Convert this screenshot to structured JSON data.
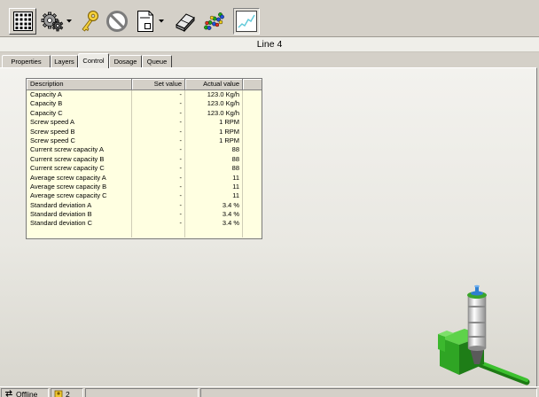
{
  "toolbar": {
    "buttons": [
      {
        "icon": "keypad-icon"
      },
      {
        "icon": "gear-icon",
        "has_dropdown": true
      },
      {
        "icon": "key-icon"
      },
      {
        "icon": "no-entry-icon"
      },
      {
        "icon": "document-icon",
        "has_dropdown": true
      },
      {
        "icon": "eraser-icon"
      },
      {
        "icon": "scatter-plot-icon"
      },
      {
        "icon": "line-chart-icon",
        "pressed": true
      }
    ]
  },
  "title": "Line 4",
  "tabs": [
    {
      "label": "Properties"
    },
    {
      "label": "Layers"
    },
    {
      "label": "Control",
      "active": true
    },
    {
      "label": "Dosage"
    },
    {
      "label": "Queue"
    }
  ],
  "table": {
    "headers": {
      "description": "Description",
      "set_value": "Set value",
      "actual_value": "Actual value"
    },
    "rows": [
      {
        "description": "Capacity A",
        "set_value": "-",
        "actual_value": "123.0 Kg/h"
      },
      {
        "description": "Capacity B",
        "set_value": "-",
        "actual_value": "123.0 Kg/h"
      },
      {
        "description": "Capacity C",
        "set_value": "-",
        "actual_value": "123.0 Kg/h"
      },
      {
        "description": "Screw speed A",
        "set_value": "-",
        "actual_value": "1 RPM"
      },
      {
        "description": "Screw speed B",
        "set_value": "-",
        "actual_value": "1 RPM"
      },
      {
        "description": "Screw speed C",
        "set_value": "-",
        "actual_value": "1 RPM"
      },
      {
        "description": "Current screw capacity A",
        "set_value": "-",
        "actual_value": "88"
      },
      {
        "description": "Current screw capacity B",
        "set_value": "-",
        "actual_value": "88"
      },
      {
        "description": "Current screw capacity C",
        "set_value": "-",
        "actual_value": "88"
      },
      {
        "description": "Average screw capacity A",
        "set_value": "-",
        "actual_value": "11"
      },
      {
        "description": "Average screw capacity B",
        "set_value": "-",
        "actual_value": "11"
      },
      {
        "description": "Average screw capacity C",
        "set_value": "-",
        "actual_value": "11"
      },
      {
        "description": "Standard deviation A",
        "set_value": "-",
        "actual_value": "3.4 %"
      },
      {
        "description": "Standard deviation B",
        "set_value": "-",
        "actual_value": "3.4 %"
      },
      {
        "description": "Standard deviation C",
        "set_value": "-",
        "actual_value": "3.4 %"
      }
    ]
  },
  "status_bar": {
    "connection_icon": "network-arrows-icon",
    "connection": "Offline",
    "count_icon": "user-icon",
    "count": "2"
  },
  "colors": {
    "toolbar_bg": "#d4d0c8",
    "table_cell_bg": "#ffffe1",
    "machine_green": "#2fa524",
    "trend_line": "#5fc9d9"
  }
}
